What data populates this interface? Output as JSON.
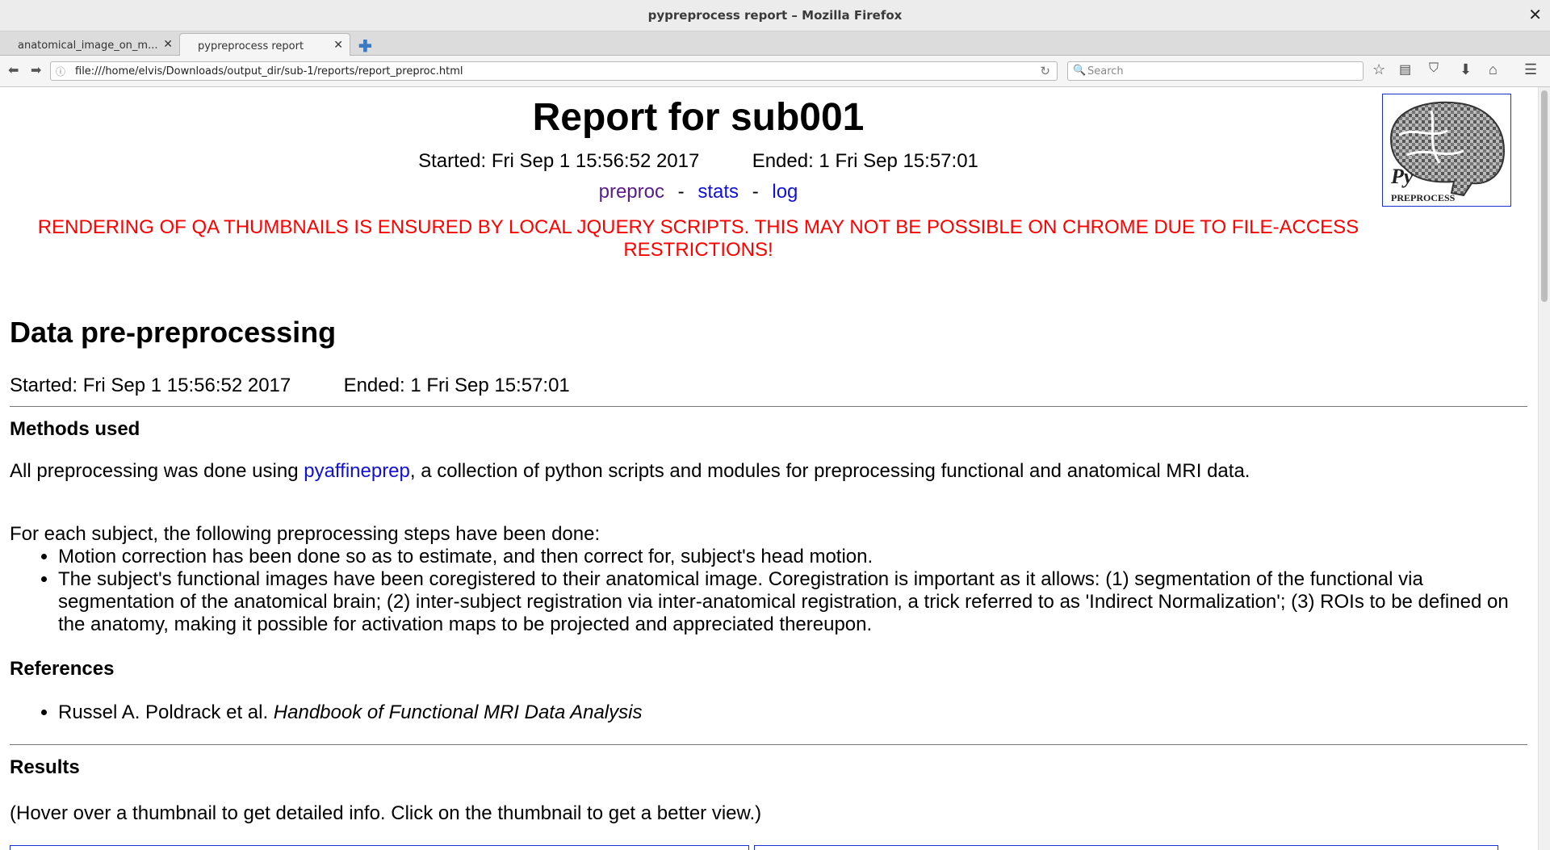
{
  "window": {
    "title": "pypreprocess report – Mozilla Firefox"
  },
  "tabs": [
    {
      "label": "anatomical_image_on_m...",
      "active": false
    },
    {
      "label": "pypreprocess report",
      "active": true
    }
  ],
  "toolbar": {
    "url": "file:///home/elvis/Downloads/output_dir/sub-1/reports/report_preproc.html",
    "search_placeholder": "Search"
  },
  "page": {
    "title": "Report for sub001",
    "started": "Started: Fri Sep 1 15:56:52 2017",
    "ended": "Ended: 1 Fri Sep 15:57:01",
    "nav_links": [
      "preproc",
      "stats",
      "log"
    ],
    "separator": "-",
    "warning_line1": "RENDERING OF QA THUMBNAILS IS ENSURED BY LOCAL JQUERY SCRIPTS. THIS MAY NOT BE POSSIBLE ON CHROME DUE TO FILE-ACCESS",
    "warning_line2": "RESTRICTIONS!",
    "logo": {
      "text_py": "Py",
      "text_pre": "PREPROCESS"
    },
    "section": {
      "heading": "Data pre-preprocessing",
      "started": "Started: Fri Sep 1 15:56:52 2017",
      "ended": "Ended: 1 Fri Sep 15:57:01",
      "methods_heading": "Methods used",
      "methods_pre": "All preprocessing was done using ",
      "methods_link": "pyaffineprep",
      "methods_post": ", a collection of python scripts and modules for preprocessing functional and anatomical MRI data.",
      "steps_intro": "For each subject, the following preprocessing steps have been done:",
      "steps": [
        "Motion correction has been done so as to estimate, and then correct for, subject's head motion.",
        "The subject's functional images have been coregistered to their anatomical image. Coregistration is important as it allows: (1) segmentation of the functional via segmentation of the anatomical brain; (2) inter-subject registration via inter-anatomical registration, a trick referred to as 'Indirect Normalization'; (3) ROIs to be defined on the anatomy, making it possible for activation maps to be projected and appreciated thereupon."
      ],
      "references_heading": "References",
      "reference_author": "Russel A. Poldrack et al. ",
      "reference_title": "Handbook of Functional MRI Data Analysis",
      "results_heading": "Results",
      "results_hint": "(Hover over a thumbnail to get detailed info. Click on the thumbnail to get a better view.)"
    }
  }
}
